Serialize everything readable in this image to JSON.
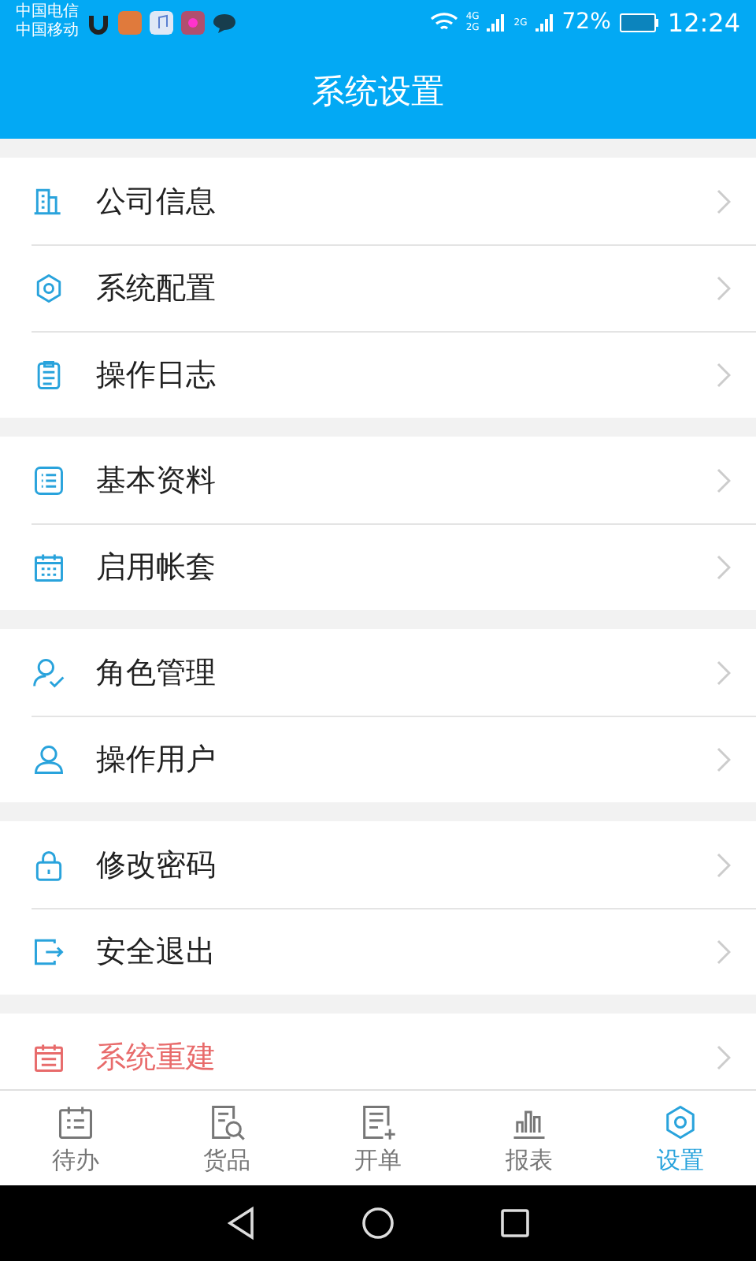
{
  "status_bar": {
    "carriers": [
      "中国电信",
      "中国移动"
    ],
    "network_labels": [
      "4G",
      "2G",
      "2G"
    ],
    "battery": "72%",
    "time": "12:24"
  },
  "header": {
    "title": "系统设置"
  },
  "groups": [
    {
      "items": [
        {
          "label": "公司信息",
          "kind": "normal"
        },
        {
          "label": "系统配置",
          "kind": "normal"
        },
        {
          "label": "操作日志",
          "kind": "normal"
        }
      ]
    },
    {
      "items": [
        {
          "label": "基本资料",
          "kind": "normal"
        },
        {
          "label": "启用帐套",
          "kind": "normal"
        }
      ]
    },
    {
      "items": [
        {
          "label": "角色管理",
          "kind": "normal"
        },
        {
          "label": "操作用户",
          "kind": "normal"
        }
      ]
    },
    {
      "items": [
        {
          "label": "修改密码",
          "kind": "normal"
        },
        {
          "label": "安全退出",
          "kind": "normal"
        }
      ]
    },
    {
      "items": [
        {
          "label": "系统重建",
          "kind": "danger"
        }
      ]
    }
  ],
  "tabs": [
    {
      "label": "待办",
      "selected": false
    },
    {
      "label": "货品",
      "selected": false
    },
    {
      "label": "开单",
      "selected": false
    },
    {
      "label": "报表",
      "selected": false
    },
    {
      "label": "设置",
      "selected": true
    }
  ]
}
